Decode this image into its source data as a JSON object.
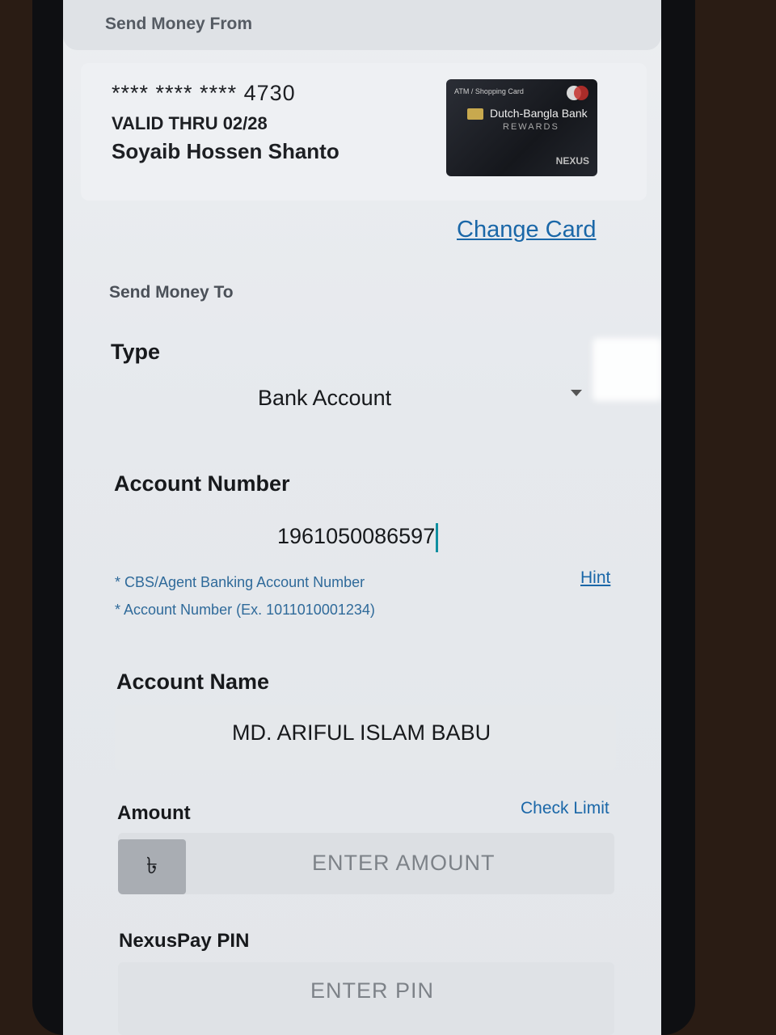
{
  "send_from": {
    "section_title": "Send Money From",
    "card_number_masked": "**** **** **** 4730",
    "valid_thru": "VALID THRU 02/28",
    "card_holder": "Soyaib Hossen Shanto",
    "card_image": {
      "type_label": "ATM / Shopping Card",
      "bank_name": "Dutch-Bangla Bank",
      "program": "REWARDS",
      "brand": "NEXUS"
    },
    "change_card_link": "Change Card"
  },
  "send_to": {
    "section_title": "Send Money To",
    "type": {
      "label": "Type",
      "selected_value": "Bank Account",
      "icon": "chevron-down-icon"
    },
    "account_number": {
      "label": "Account Number",
      "value": "1961050086597",
      "notes": [
        "* CBS/Agent Banking Account Number",
        "* Account Number (Ex. 1011010001234)"
      ],
      "hint_link": "Hint"
    },
    "account_name": {
      "label": "Account Name",
      "value": "MD. ARIFUL ISLAM BABU"
    },
    "amount": {
      "label": "Amount",
      "check_limit_link": "Check Limit",
      "currency_symbol": "৳",
      "placeholder": "ENTER AMOUNT"
    },
    "pin": {
      "label": "NexusPay PIN",
      "placeholder": "ENTER PIN"
    }
  },
  "colors": {
    "link": "#1a67a8",
    "note_text": "#2f6a9a",
    "cursor": "#0f8fa0",
    "screen_bg": "#e6e9ed"
  }
}
